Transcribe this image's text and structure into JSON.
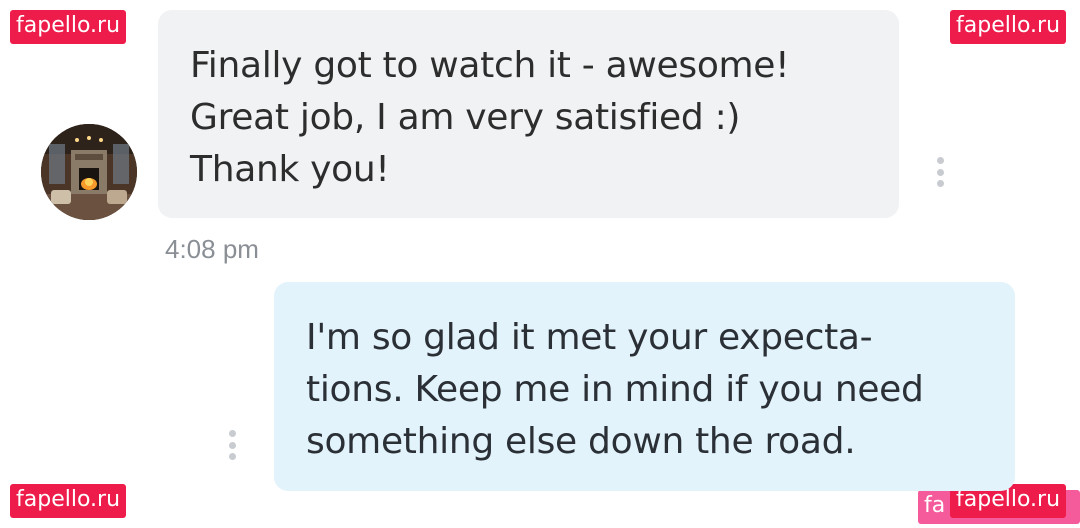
{
  "watermark": {
    "text": "fapello.ru",
    "partial_text": "fa"
  },
  "incoming_message": {
    "lines": [
      "Finally got to watch it - awesome!",
      "Great job, I am very satisfied :)",
      "Thank you!"
    ],
    "timestamp": "4:08 pm",
    "avatar": "fireplace-room-photo"
  },
  "outgoing_message": {
    "lines": [
      "I'm so glad it met your expecta-",
      "tions. Keep me in mind if you need",
      "something else down the road."
    ]
  },
  "icons": {
    "more_options": "vertical-ellipsis-icon"
  },
  "colors": {
    "incoming_bubble": "#f0f2f4",
    "outgoing_bubble": "#e2f3fb",
    "watermark_bg": "#ee1c4a",
    "timestamp_text": "#8a8f95"
  }
}
